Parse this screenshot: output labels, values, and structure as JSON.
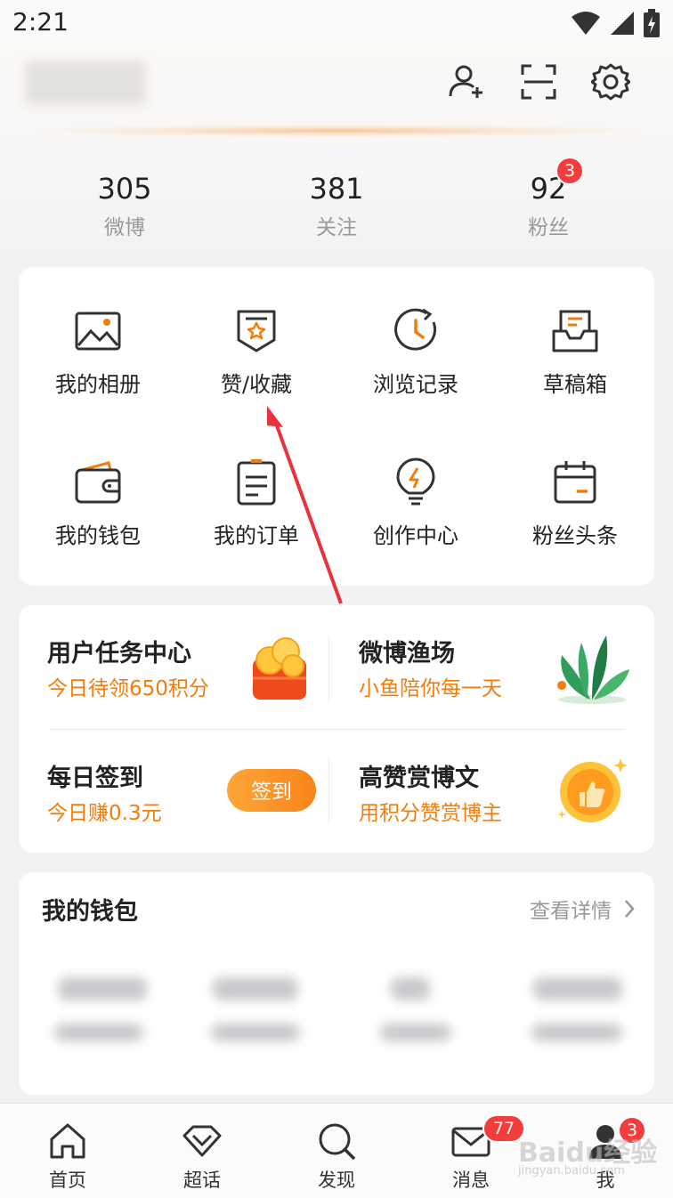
{
  "status_bar": {
    "time": "2:21"
  },
  "header": {
    "icons": [
      "add-friend-icon",
      "scan-icon",
      "settings-icon"
    ]
  },
  "stats": [
    {
      "value": "305",
      "label": "微博"
    },
    {
      "value": "381",
      "label": "关注"
    },
    {
      "value": "92",
      "label": "粉丝",
      "badge": "3"
    }
  ],
  "grid": [
    {
      "label": "我的相册",
      "icon": "photo-album-icon"
    },
    {
      "label": "赞/收藏",
      "icon": "bookmark-star-icon"
    },
    {
      "label": "浏览记录",
      "icon": "history-clock-icon"
    },
    {
      "label": "草稿箱",
      "icon": "drafts-tray-icon"
    },
    {
      "label": "我的钱包",
      "icon": "wallet-icon"
    },
    {
      "label": "我的订单",
      "icon": "order-list-icon"
    },
    {
      "label": "创作中心",
      "icon": "lightbulb-icon"
    },
    {
      "label": "粉丝头条",
      "icon": "calendar-icon"
    }
  ],
  "tasks": [
    {
      "title": "用户任务中心",
      "subtitle": "今日待领650积分",
      "icon": "coin-chest-icon"
    },
    {
      "title": "微博渔场",
      "subtitle": "小鱼陪你每一天",
      "icon": "plant-illustration-icon"
    },
    {
      "title": "每日签到",
      "subtitle": "今日赚0.3元",
      "button": "签到"
    },
    {
      "title": "高赞赏博文",
      "subtitle": "用积分赞赏博主",
      "icon": "thumbs-up-coin-icon"
    }
  ],
  "wallet": {
    "title": "我的钱包",
    "link": "查看详情"
  },
  "tabbar": [
    {
      "label": "首页",
      "icon": "home-icon"
    },
    {
      "label": "超话",
      "icon": "diamond-icon"
    },
    {
      "label": "发现",
      "icon": "search-icon"
    },
    {
      "label": "消息",
      "icon": "mail-icon",
      "badge": "77"
    },
    {
      "label": "我",
      "icon": "profile-icon",
      "badge": "3"
    }
  ],
  "watermark": {
    "text": "Baidu经验",
    "sub": "jingyan.baidu.com"
  },
  "colors": {
    "accent": "#f27d0c",
    "badge": "#f23d3d",
    "annotation_arrow": "#e8323c"
  }
}
